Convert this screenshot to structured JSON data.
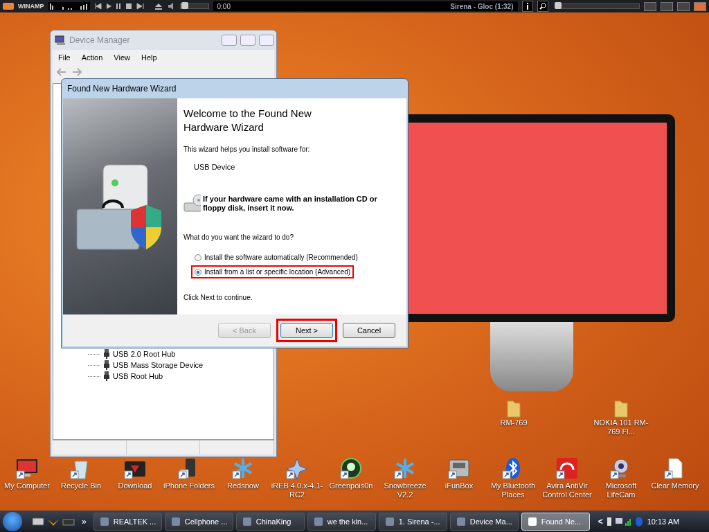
{
  "media_player": {
    "name": "WINAMP",
    "time": "0:00",
    "track": "Sirena - Gloc (1:32)",
    "volume": {
      "level": 0.08
    },
    "seek": {
      "level": 0
    }
  },
  "device_manager": {
    "title": "Device Manager",
    "menu": [
      "File",
      "Action",
      "View",
      "Help"
    ],
    "tree": [
      {
        "label": "USB 2.0 Root Hub"
      },
      {
        "label": "USB Mass Storage Device"
      },
      {
        "label": "USB Root Hub"
      }
    ]
  },
  "wizard": {
    "title": "Found New Hardware Wizard",
    "heading": "Welcome to the Found New Hardware Wizard",
    "intro": "This wizard helps you install software for:",
    "device": "USB Device",
    "cd_prompt": "If your hardware came with an installation CD or floppy disk, insert it now.",
    "question": "What do you want the wizard to do?",
    "options": [
      {
        "label": "Install the software automatically (Recommended)",
        "selected": false,
        "highlighted": false
      },
      {
        "label": "Install from a list or specific location (Advanced)",
        "selected": true,
        "highlighted": true
      }
    ],
    "footer": "Click Next to continue.",
    "buttons": [
      {
        "label": "< Back",
        "disabled": true,
        "highlighted": false
      },
      {
        "label": "Next >",
        "disabled": false,
        "highlighted": true
      },
      {
        "label": "Cancel",
        "disabled": false,
        "highlighted": false
      }
    ]
  },
  "folders": [
    {
      "label": "RM-769"
    },
    {
      "label": "NOKIA 101 RM-769 Fl..."
    }
  ],
  "desktop_icons": [
    {
      "label": "My Computer",
      "kind": "computer"
    },
    {
      "label": "Recycle Bin",
      "kind": "bin"
    },
    {
      "label": "Download",
      "kind": "dark-folder"
    },
    {
      "label": "iPhone Folders",
      "kind": "phone"
    },
    {
      "label": "Redsnow",
      "kind": "snowflake"
    },
    {
      "label": "iREB 4.0.x-4.1-RC2",
      "kind": "star"
    },
    {
      "label": "Greenpois0n",
      "kind": "green-circle"
    },
    {
      "label": "Snowbreeze V2.2",
      "kind": "snowflake"
    },
    {
      "label": "iFunBox",
      "kind": "box"
    },
    {
      "label": "My Bluetooth Places",
      "kind": "bluetooth"
    },
    {
      "label": "Avira AntiVir Control Center",
      "kind": "umbrella"
    },
    {
      "label": "Microsoft LifeCam",
      "kind": "webcam"
    },
    {
      "label": "Clear Memory",
      "kind": "document"
    }
  ],
  "taskbar": {
    "tasks": [
      {
        "label": "REALTEK ...",
        "selected": false
      },
      {
        "label": "Cellphone ...",
        "selected": false
      },
      {
        "label": "ChinaKing",
        "selected": false
      },
      {
        "label": "we the kin...",
        "selected": false
      },
      {
        "label": "1. Sirena -...",
        "selected": false
      },
      {
        "label": "Device Ma...",
        "selected": false
      },
      {
        "label": "Found Ne...",
        "selected": true
      }
    ],
    "overflow": "»",
    "tray_expand": "<",
    "clock": "10:13 AM"
  }
}
